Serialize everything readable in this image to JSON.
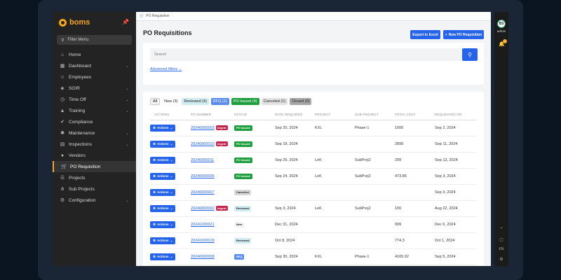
{
  "app": {
    "logo_text": "boms",
    "filter_menu_label": "Filter Menu"
  },
  "sidebar": {
    "items": [
      {
        "label": "Home",
        "icon": "home-icon",
        "glyph": "⌂",
        "chevron": false
      },
      {
        "label": "Dashboard",
        "icon": "dashboard-icon",
        "glyph": "▦",
        "chevron": true
      },
      {
        "label": "Employees",
        "icon": "users-icon",
        "glyph": "☺",
        "chevron": false
      },
      {
        "label": "SOIR",
        "icon": "shield-icon",
        "glyph": "◈",
        "chevron": true
      },
      {
        "label": "Time Off",
        "icon": "clock-icon",
        "glyph": "◷",
        "chevron": true
      },
      {
        "label": "Training",
        "icon": "graduation-cap-icon",
        "glyph": "▲",
        "chevron": true
      },
      {
        "label": "Compliance",
        "icon": "check-shield-icon",
        "glyph": "✔",
        "chevron": false
      },
      {
        "label": "Maintenance",
        "icon": "tools-icon",
        "glyph": "✱",
        "chevron": true
      },
      {
        "label": "Inspections",
        "icon": "clipboard-icon",
        "glyph": "▤",
        "chevron": true
      },
      {
        "label": "Vendors",
        "icon": "user-tie-icon",
        "glyph": "●",
        "chevron": false
      },
      {
        "label": "PO Requisition",
        "icon": "cart-icon",
        "glyph": "🛒",
        "chevron": false,
        "active": true
      },
      {
        "label": "Projects",
        "icon": "list-icon",
        "glyph": "☰",
        "chevron": false
      },
      {
        "label": "Sub Projects",
        "icon": "sitemap-icon",
        "glyph": "⋔",
        "chevron": false
      },
      {
        "label": "Configuration",
        "icon": "gear-icon",
        "glyph": "⚙",
        "chevron": true
      }
    ]
  },
  "rail": {
    "avatar_initials": "BS",
    "user_name": "admin",
    "notification_count": "1",
    "language": "EN"
  },
  "header": {
    "breadcrumb": "PO Requisition",
    "title": "PO Requisitions",
    "export_label": "Export to Excel",
    "new_label": "New PO Requisition"
  },
  "search": {
    "placeholder": "Search",
    "advanced_label": "Advanced filters"
  },
  "tabs": [
    {
      "label": "All",
      "cls": "all"
    },
    {
      "label": "New (3)",
      "cls": "new"
    },
    {
      "label": "Reviewed (4)",
      "cls": "rev"
    },
    {
      "label": "RFQ (2)",
      "cls": "rfq"
    },
    {
      "label": "PO Issued (4)",
      "cls": "issued"
    },
    {
      "label": "Canceled (1)",
      "cls": "canc"
    },
    {
      "label": "Closed (0)",
      "cls": "closed"
    }
  ],
  "table": {
    "columns": [
      "ACTIONS",
      "PO NUMBER",
      "STATUS",
      "DATE REQUIRED",
      "PROJECT",
      "SUB PROJECT",
      "TOTAL COST",
      "REQUESTED ON"
    ],
    "action_label": "Actions",
    "urgent_label": "Urgent",
    "rows": [
      {
        "po": "20240900003",
        "urgent": true,
        "status": "PO Issued",
        "status_cls": "b-issued",
        "date_required": "Sep 20, 2024",
        "project": "KXL",
        "sub_project": "Phase-1",
        "total": "1000",
        "requested_on": "Sep 2, 2024"
      },
      {
        "po": "20240900010",
        "urgent": true,
        "status": "PO Issued",
        "status_cls": "b-issued",
        "date_required": "Sep 18, 2024",
        "project": "",
        "sub_project": "",
        "total": "2899",
        "requested_on": "Sep 11, 2024"
      },
      {
        "po": "20240900011",
        "urgent": false,
        "status": "PO Issued",
        "status_cls": "b-issued",
        "date_required": "Sep 26, 2024",
        "project": "LeK",
        "sub_project": "SubProj2",
        "total": "299",
        "requested_on": "Sep 13, 2024"
      },
      {
        "po": "20240900006",
        "urgent": false,
        "status": "PO Issued",
        "status_cls": "b-issued",
        "date_required": "Sep 24, 2024",
        "project": "LeK",
        "sub_project": "SubProj2",
        "total": "473.85",
        "requested_on": "Sep 3, 2024"
      },
      {
        "po": "20240900007",
        "urgent": false,
        "status": "Canceled",
        "status_cls": "b-canceled",
        "date_required": "",
        "project": "",
        "sub_project": "",
        "total": "",
        "requested_on": "Sep 3, 2024"
      },
      {
        "po": "20240800002",
        "urgent": true,
        "status": "Reviewed",
        "status_cls": "b-reviewed",
        "date_required": "Sep 3, 2024",
        "project": "LeK",
        "sub_project": "SubProj2",
        "total": "100",
        "requested_on": "Aug 22, 2024"
      },
      {
        "po": "20241200021",
        "urgent": false,
        "status": "New",
        "status_cls": "b-new",
        "date_required": "Dec 31, 2024",
        "project": "",
        "sub_project": "",
        "total": "999",
        "requested_on": "Dec 6, 2024"
      },
      {
        "po": "20241000018",
        "urgent": false,
        "status": "Reviewed",
        "status_cls": "b-reviewed",
        "date_required": "Oct 8, 2024",
        "project": "",
        "sub_project": "",
        "total": "774.3",
        "requested_on": "Oct 1, 2024"
      },
      {
        "po": "20240900008",
        "urgent": false,
        "status": "RFQ",
        "status_cls": "b-rfq",
        "date_required": "Sep 30, 2024",
        "project": "KXL",
        "sub_project": "Phase-1",
        "total": "4165.92",
        "requested_on": "Sep 5, 2024"
      }
    ]
  },
  "colors": {
    "accent": "#2563eb",
    "brand": "#f5a623",
    "po_issued": "#1e9e3e",
    "urgent": "#c0244b"
  }
}
